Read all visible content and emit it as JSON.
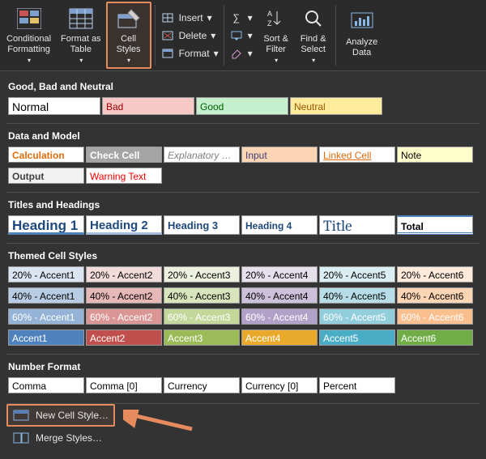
{
  "ribbon": {
    "cond_format": "Conditional\nFormatting",
    "format_as_table": "Format as\nTable",
    "cell_styles": "Cell\nStyles",
    "insert": "Insert",
    "delete": "Delete",
    "format": "Format",
    "sort_filter": "Sort &\nFilter",
    "find_select": "Find &\nSelect",
    "analyze_data": "Analyze\nData"
  },
  "sections": {
    "good_bad": {
      "title": "Good, Bad and Neutral",
      "items": [
        {
          "label": "Normal",
          "bg": "#ffffff",
          "color": "#000",
          "font": "14px"
        },
        {
          "label": "Bad",
          "bg": "#f6c9c6",
          "color": "#9c0006"
        },
        {
          "label": "Good",
          "bg": "#c6efce",
          "color": "#006100"
        },
        {
          "label": "Neutral",
          "bg": "#ffeb9c",
          "color": "#9c5700"
        }
      ]
    },
    "data_model": {
      "title": "Data and Model",
      "rows": [
        [
          {
            "label": "Calculation",
            "bg": "#fff",
            "color": "#e26b0a",
            "bold": true,
            "border": "#7f7f7f"
          },
          {
            "label": "Check Cell",
            "bg": "#a5a5a5",
            "color": "#fff",
            "bold": true
          },
          {
            "label": "Explanatory …",
            "bg": "#fff",
            "color": "#7f7f7f",
            "italic": true
          },
          {
            "label": "Input",
            "bg": "#fcd5b4",
            "color": "#3f3f76"
          },
          {
            "label": "Linked Cell",
            "bg": "#fff",
            "color": "#e26b0a",
            "underline": true
          },
          {
            "label": "Note",
            "bg": "#ffffcc",
            "color": "#000"
          }
        ],
        [
          {
            "label": "Output",
            "bg": "#f2f2f2",
            "color": "#3f3f3f",
            "bold": true
          },
          {
            "label": "Warning Text",
            "bg": "#fff",
            "color": "#ff0000"
          }
        ]
      ]
    },
    "titles": {
      "title": "Titles and Headings",
      "items": [
        {
          "label": "Heading 1",
          "bg": "#fff",
          "color": "#1f497d",
          "bold": true,
          "font": "17px",
          "underlineBar": "#4f81bd"
        },
        {
          "label": "Heading 2",
          "bg": "#fff",
          "color": "#1f497d",
          "bold": true,
          "font": "15px",
          "underlineBar": "#a7bfde"
        },
        {
          "label": "Heading 3",
          "bg": "#fff",
          "color": "#1f497d",
          "bold": true,
          "font": "13px"
        },
        {
          "label": "Heading 4",
          "bg": "#fff",
          "color": "#1f497d",
          "bold": true,
          "font": "12px"
        },
        {
          "label": "Title",
          "bg": "#fff",
          "color": "#1f497d",
          "font": "19px",
          "family": "Cambria, serif"
        },
        {
          "label": "Total",
          "bg": "#fff",
          "color": "#000",
          "bold": true,
          "topBar": "#4f81bd",
          "botBar": "#4f81bd"
        }
      ]
    },
    "themed": {
      "title": "Themed Cell Styles",
      "rows": [
        [
          {
            "label": "20% - Accent1",
            "bg": "#dbe5f1"
          },
          {
            "label": "20% - Accent2",
            "bg": "#f2dcdb"
          },
          {
            "label": "20% - Accent3",
            "bg": "#ebf1de"
          },
          {
            "label": "20% - Accent4",
            "bg": "#e5e0ec"
          },
          {
            "label": "20% - Accent5",
            "bg": "#dbeef4"
          },
          {
            "label": "20% - Accent6",
            "bg": "#fdeada"
          }
        ],
        [
          {
            "label": "40% - Accent1",
            "bg": "#b8cce4"
          },
          {
            "label": "40% - Accent2",
            "bg": "#e6b8b7"
          },
          {
            "label": "40% - Accent3",
            "bg": "#d8e4bc"
          },
          {
            "label": "40% - Accent4",
            "bg": "#ccc0da"
          },
          {
            "label": "40% - Accent5",
            "bg": "#b7dee8"
          },
          {
            "label": "40% - Accent6",
            "bg": "#fcd5b4"
          }
        ],
        [
          {
            "label": "60% - Accent1",
            "bg": "#95b3d7",
            "color": "#fff"
          },
          {
            "label": "60% - Accent2",
            "bg": "#da9694",
            "color": "#fff"
          },
          {
            "label": "60% - Accent3",
            "bg": "#c4d79b",
            "color": "#fff"
          },
          {
            "label": "60% - Accent4",
            "bg": "#b1a0c7",
            "color": "#fff"
          },
          {
            "label": "60% - Accent5",
            "bg": "#92cddc",
            "color": "#fff"
          },
          {
            "label": "60% - Accent6",
            "bg": "#fabf8f",
            "color": "#fff"
          }
        ],
        [
          {
            "label": "Accent1",
            "bg": "#4f81bd",
            "color": "#fff"
          },
          {
            "label": "Accent2",
            "bg": "#c0504d",
            "color": "#fff"
          },
          {
            "label": "Accent3",
            "bg": "#9bbb59",
            "color": "#fff"
          },
          {
            "label": "Accent4",
            "bg": "#e9aa2b",
            "color": "#fff"
          },
          {
            "label": "Accent5",
            "bg": "#4bacc6",
            "color": "#fff"
          },
          {
            "label": "Accent6",
            "bg": "#70ad47",
            "color": "#fff"
          }
        ]
      ]
    },
    "number_format": {
      "title": "Number Format",
      "items": [
        {
          "label": "Comma"
        },
        {
          "label": "Comma [0]"
        },
        {
          "label": "Currency"
        },
        {
          "label": "Currency [0]"
        },
        {
          "label": "Percent"
        }
      ]
    }
  },
  "footer": {
    "new_cell_style": "New Cell Style…",
    "merge_styles": "Merge Styles…"
  }
}
